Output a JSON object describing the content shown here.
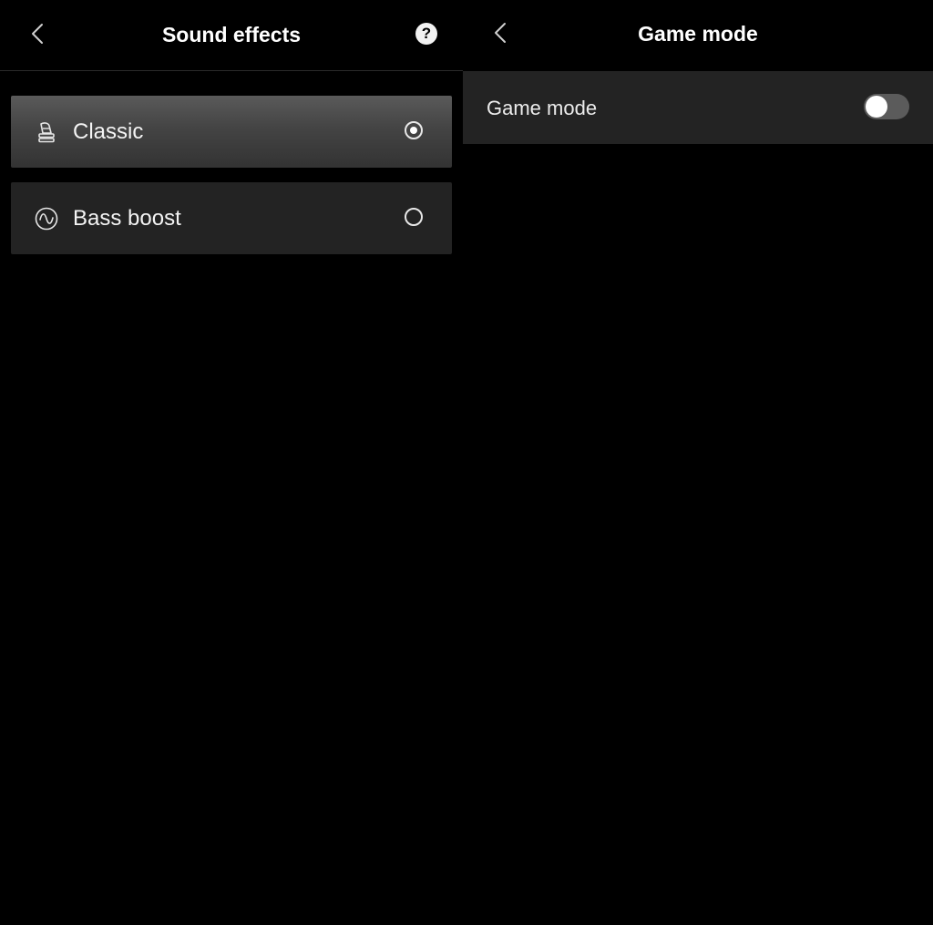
{
  "sound_effects_panel": {
    "title": "Sound effects",
    "back_icon": "chevron-left-icon",
    "help_icon": "question-circle-icon",
    "help_glyph": "?",
    "items": [
      {
        "label": "Classic",
        "icon": "gramophone-icon",
        "selected": true
      },
      {
        "label": "Bass boost",
        "icon": "sine-wave-icon",
        "selected": false
      }
    ]
  },
  "game_mode_panel": {
    "title": "Game mode",
    "back_icon": "chevron-left-icon",
    "settings": [
      {
        "label": "Game mode",
        "enabled": false
      }
    ]
  },
  "colors": {
    "background": "#000000",
    "item_background": "#232323",
    "selected_item_top": "#5a5a5a",
    "toggle_off_track": "#5b5b5b",
    "text": "#ffffff"
  }
}
